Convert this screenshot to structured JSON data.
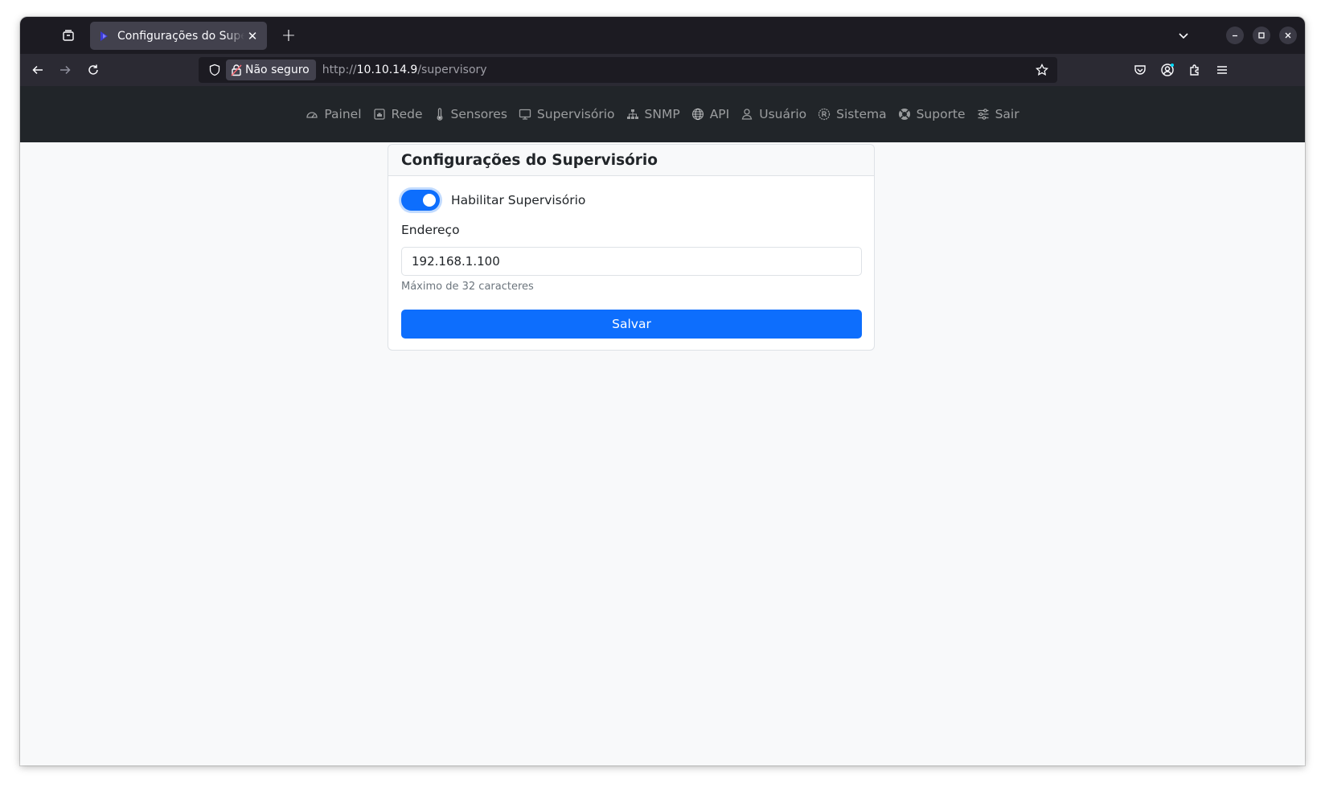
{
  "browser": {
    "tab": {
      "title": "Configurações do Supervisório",
      "close_glyph": "✕"
    },
    "new_tab_glyph": "+",
    "urlbar": {
      "security_label": "Não seguro",
      "url_scheme": "http://",
      "url_host": "10.10.14.9",
      "url_path": "/supervisory"
    }
  },
  "app_nav": {
    "items": [
      {
        "label": "Painel",
        "icon": "speedometer-icon"
      },
      {
        "label": "Rede",
        "icon": "ethernet-icon"
      },
      {
        "label": "Sensores",
        "icon": "thermometer-icon"
      },
      {
        "label": "Supervisório",
        "icon": "monitor-icon"
      },
      {
        "label": "SNMP",
        "icon": "network-tree-icon"
      },
      {
        "label": "API",
        "icon": "globe-icon"
      },
      {
        "label": "Usuário",
        "icon": "person-icon"
      },
      {
        "label": "Sistema",
        "icon": "cpu-badge-icon"
      },
      {
        "label": "Suporte",
        "icon": "life-buoy-icon"
      },
      {
        "label": "Sair",
        "icon": "sliders-icon"
      }
    ]
  },
  "card": {
    "title": "Configurações do Supervisório",
    "enable_switch": {
      "label": "Habilitar Supervisório",
      "checked": true
    },
    "address": {
      "label": "Endereço",
      "value": "192.168.1.100",
      "help": "Máximo de 32 caracteres"
    },
    "save_label": "Salvar"
  },
  "colors": {
    "primary": "#0d6efd",
    "navbar_bg": "#212529",
    "page_bg": "#f8f9fa"
  }
}
